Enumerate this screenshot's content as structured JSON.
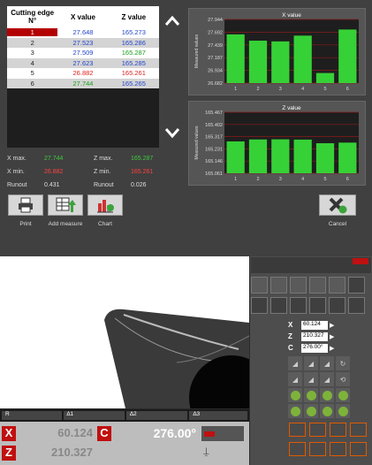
{
  "table": {
    "headers": [
      "Cutting edge N°",
      "X value",
      "Z value"
    ],
    "rows": [
      {
        "n": "1",
        "x": "27.648",
        "z": "165.273",
        "xc": "#2244cc",
        "zc": "#2244cc"
      },
      {
        "n": "2",
        "x": "27.523",
        "z": "165.286",
        "xc": "#2244cc",
        "zc": "#2244cc"
      },
      {
        "n": "3",
        "x": "27.509",
        "z": "165.287",
        "xc": "#2244cc",
        "zc": "#1a9e1a"
      },
      {
        "n": "4",
        "x": "27.623",
        "z": "165.285",
        "xc": "#2244cc",
        "zc": "#2244cc"
      },
      {
        "n": "5",
        "x": "26.882",
        "z": "165.261",
        "xc": "#e02020",
        "zc": "#e02020"
      },
      {
        "n": "6",
        "x": "27.744",
        "z": "165.265",
        "xc": "#1a9e1a",
        "zc": "#2244cc"
      }
    ]
  },
  "stats": {
    "xmax_label": "X max.",
    "xmax": "27.744",
    "zmax_label": "Z max.",
    "zmax": "165.287",
    "xmin_label": "X min.",
    "xmin": "26.882",
    "zmin_label": "Z min.",
    "zmin": "165.261",
    "runout_label": "Runout",
    "xrun": "0.431",
    "zrunout_label": "Runout",
    "zrun": "0.026"
  },
  "toolbar": {
    "print": "Print",
    "add_measure": "Add measure",
    "chart": "Chart",
    "cancel": "Cancel"
  },
  "chart_data": [
    {
      "type": "bar",
      "title": "X value",
      "ylabel": "Measured values",
      "categories": [
        "1",
        "2",
        "3",
        "4",
        "5",
        "6"
      ],
      "values": [
        27.648,
        27.523,
        27.509,
        27.623,
        26.882,
        27.744
      ],
      "yticks": [
        "27.944",
        "27.692",
        "27.439",
        "27.187",
        "26.934",
        "26.682"
      ],
      "ylim": [
        26.682,
        27.944
      ]
    },
    {
      "type": "bar",
      "title": "Z value",
      "ylabel": "Measured values",
      "categories": [
        "1",
        "2",
        "3",
        "4",
        "5",
        "6"
      ],
      "values": [
        165.273,
        165.286,
        165.287,
        165.285,
        165.261,
        165.265
      ],
      "yticks": [
        "165.467",
        "165.402",
        "165.317",
        "165.231",
        "165.146",
        "165.061"
      ],
      "ylim": [
        165.061,
        165.467
      ]
    }
  ],
  "measure": {
    "x_label": "X",
    "x_value": "60.124",
    "z_label": "Z",
    "z_value": "210.327",
    "c_label": "C",
    "c_value": "276.00°"
  },
  "status": {
    "r_label": "R",
    "a1": "∆1",
    "a2": "∆2",
    "a3": "∆3",
    "x_big": "60.124",
    "z_big": "210.327",
    "c_big": "276.00°",
    "xs": "X",
    "zs": "Z",
    "cs": "C"
  }
}
